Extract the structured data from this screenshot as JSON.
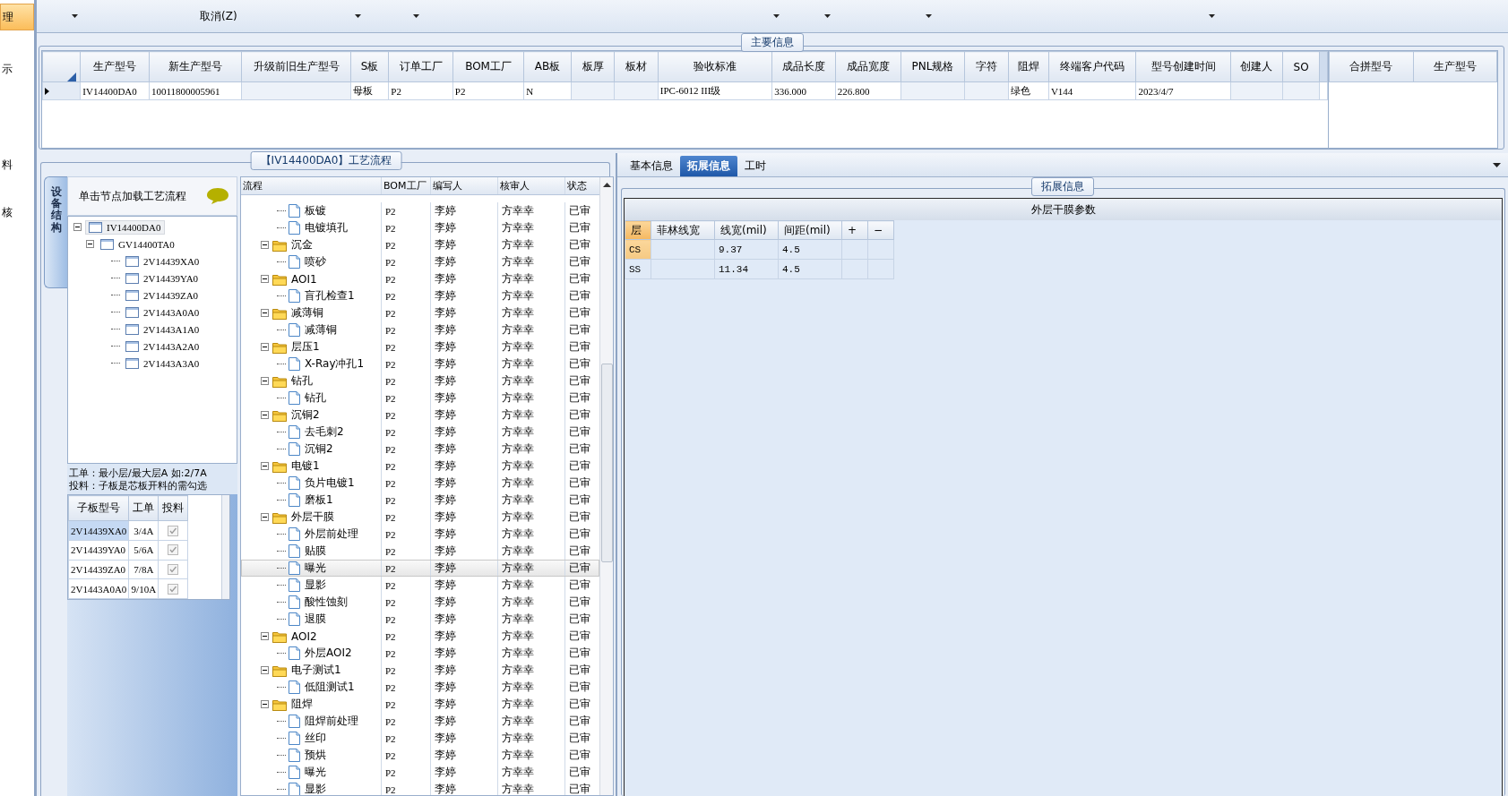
{
  "nav": [
    {
      "label": "理",
      "selected": true
    },
    {
      "label": "示",
      "selected": false
    },
    {
      "label": "料",
      "selected": false
    },
    {
      "label": "核",
      "selected": false
    }
  ],
  "toolbar": [
    {
      "kind": "dropdown"
    },
    {
      "kind": "button",
      "label": "取消(Z)"
    },
    {
      "kind": "dropdown"
    },
    {
      "kind": "dropdown"
    },
    {
      "kind": "dropdown"
    },
    {
      "kind": "dropdown"
    },
    {
      "kind": "dropdown"
    },
    {
      "kind": "dropdown"
    }
  ],
  "main_info": {
    "title": "主要信息",
    "columns": [
      "生产型号",
      "新生产型号",
      "升级前旧生产型号",
      "S板",
      "订单工厂",
      "BOM工厂",
      "AB板",
      "板厚",
      "板材",
      "验收标准",
      "成品长度",
      "成品宽度",
      "PNL规格",
      "字符",
      "阻焊",
      "终端客户代码",
      "型号创建时间",
      "创建人",
      "SO"
    ],
    "rows": [
      {
        "selected": true,
        "cells": [
          "IV14400DA0",
          "10011800005961",
          null,
          "母板",
          "P2",
          "P2",
          "N",
          null,
          null,
          "IPC-6012 III级",
          "336.000",
          "226.800",
          null,
          null,
          "绿色",
          "V144",
          "2023/4/7",
          null,
          null
        ]
      }
    ],
    "merge_columns": [
      "合拼型号",
      "生产型号"
    ]
  },
  "process": {
    "title": "【IV14400DA0】工艺流程",
    "side_tab": "设备结构",
    "tree_hint": "单击节点加载工艺流程",
    "tree": [
      {
        "label": "IV14400DA0",
        "selected": true,
        "expanded": true,
        "children": [
          {
            "label": "GV14400TA0",
            "selected": false,
            "expanded": true,
            "children": [
              {
                "label": "2V14439XA0",
                "selected": false
              },
              {
                "label": "2V14439YA0",
                "selected": false
              },
              {
                "label": "2V14439ZA0",
                "selected": false
              },
              {
                "label": "2V1443A0A0",
                "selected": false
              },
              {
                "label": "2V1443A1A0",
                "selected": false
              },
              {
                "label": "2V1443A2A0",
                "selected": false
              },
              {
                "label": "2V1443A3A0",
                "selected": false
              }
            ]
          }
        ]
      }
    ],
    "notes": [
      "工单：最小层/最大层A 如:2/7A",
      "投料：子板是芯板开料的需勾选"
    ],
    "sub_boards": {
      "columns": [
        "子板型号",
        "工单",
        "投料"
      ],
      "rows": [
        {
          "board": "2V14439XA0",
          "order": "3/4A",
          "checked": true,
          "selected": true
        },
        {
          "board": "2V14439YA0",
          "order": "5/6A",
          "checked": true,
          "selected": false
        },
        {
          "board": "2V14439ZA0",
          "order": "7/8A",
          "checked": true,
          "selected": false
        },
        {
          "board": "2V1443A0A0",
          "order": "9/10A",
          "checked": true,
          "selected": false
        }
      ]
    }
  },
  "flow": {
    "columns": [
      "流程",
      "BOM工厂",
      "编写人",
      "核审人",
      "状态"
    ],
    "rows": [
      {
        "children": [
          {
            "name": "板镀",
            "bom": "P2",
            "writer": "李婷",
            "reviewer": "方幸幸",
            "status": "已审",
            "selected": false
          },
          {
            "name": "电镀填孔",
            "bom": "P2",
            "writer": "李婷",
            "reviewer": "方幸幸",
            "status": "已审",
            "selected": false
          }
        ]
      },
      {
        "name": "沉金",
        "bom": "P2",
        "writer": "李婷",
        "reviewer": "方幸幸",
        "status": "已审",
        "selected": false,
        "expanded": true,
        "children": [
          {
            "name": "喷砂",
            "bom": "P2",
            "writer": "李婷",
            "reviewer": "方幸幸",
            "status": "已审",
            "selected": false
          }
        ]
      },
      {
        "name": "AOI1",
        "bom": "P2",
        "writer": "李婷",
        "reviewer": "方幸幸",
        "status": "已审",
        "selected": false,
        "expanded": true,
        "children": [
          {
            "name": "盲孔检查1",
            "bom": "P2",
            "writer": "李婷",
            "reviewer": "方幸幸",
            "status": "已审",
            "selected": false
          }
        ]
      },
      {
        "name": "减薄铜",
        "bom": "P2",
        "writer": "李婷",
        "reviewer": "方幸幸",
        "status": "已审",
        "selected": false,
        "expanded": true,
        "children": [
          {
            "name": "减薄铜",
            "bom": "P2",
            "writer": "李婷",
            "reviewer": "方幸幸",
            "status": "已审",
            "selected": false
          }
        ]
      },
      {
        "name": "层压1",
        "bom": "P2",
        "writer": "李婷",
        "reviewer": "方幸幸",
        "status": "已审",
        "selected": false,
        "expanded": true,
        "children": [
          {
            "name": "X-Ray冲孔1",
            "bom": "P2",
            "writer": "李婷",
            "reviewer": "方幸幸",
            "status": "已审",
            "selected": false
          }
        ]
      },
      {
        "name": "钻孔",
        "bom": "P2",
        "writer": "李婷",
        "reviewer": "方幸幸",
        "status": "已审",
        "selected": false,
        "expanded": true,
        "children": [
          {
            "name": "钻孔",
            "bom": "P2",
            "writer": "李婷",
            "reviewer": "方幸幸",
            "status": "已审",
            "selected": false
          }
        ]
      },
      {
        "name": "沉铜2",
        "bom": "P2",
        "writer": "李婷",
        "reviewer": "方幸幸",
        "status": "已审",
        "selected": false,
        "expanded": true,
        "children": [
          {
            "name": "去毛刺2",
            "bom": "P2",
            "writer": "李婷",
            "reviewer": "方幸幸",
            "status": "已审",
            "selected": false
          },
          {
            "name": "沉铜2",
            "bom": "P2",
            "writer": "李婷",
            "reviewer": "方幸幸",
            "status": "已审",
            "selected": false
          }
        ]
      },
      {
        "name": "电镀1",
        "bom": "P2",
        "writer": "李婷",
        "reviewer": "方幸幸",
        "status": "已审",
        "selected": false,
        "expanded": true,
        "children": [
          {
            "name": "负片电镀1",
            "bom": "P2",
            "writer": "李婷",
            "reviewer": "方幸幸",
            "status": "已审",
            "selected": false
          },
          {
            "name": "磨板1",
            "bom": "P2",
            "writer": "李婷",
            "reviewer": "方幸幸",
            "status": "已审",
            "selected": false
          }
        ]
      },
      {
        "name": "外层干膜",
        "bom": "P2",
        "writer": "李婷",
        "reviewer": "方幸幸",
        "status": "已审",
        "selected": false,
        "expanded": true,
        "children": [
          {
            "name": "外层前处理",
            "bom": "P2",
            "writer": "李婷",
            "reviewer": "方幸幸",
            "status": "已审",
            "selected": false
          },
          {
            "name": "贴膜",
            "bom": "P2",
            "writer": "李婷",
            "reviewer": "方幸幸",
            "status": "已审",
            "selected": false
          },
          {
            "name": "曝光",
            "bom": "P2",
            "writer": "李婷",
            "reviewer": "方幸幸",
            "status": "已审",
            "selected": true
          },
          {
            "name": "显影",
            "bom": "P2",
            "writer": "李婷",
            "reviewer": "方幸幸",
            "status": "已审",
            "selected": false
          },
          {
            "name": "酸性蚀刻",
            "bom": "P2",
            "writer": "李婷",
            "reviewer": "方幸幸",
            "status": "已审",
            "selected": false
          },
          {
            "name": "退膜",
            "bom": "P2",
            "writer": "李婷",
            "reviewer": "方幸幸",
            "status": "已审",
            "selected": false
          }
        ]
      },
      {
        "name": "AOI2",
        "bom": "P2",
        "writer": "李婷",
        "reviewer": "方幸幸",
        "status": "已审",
        "selected": false,
        "expanded": true,
        "children": [
          {
            "name": "外层AOI2",
            "bom": "P2",
            "writer": "李婷",
            "reviewer": "方幸幸",
            "status": "已审",
            "selected": false
          }
        ]
      },
      {
        "name": "电子测试1",
        "bom": "P2",
        "writer": "李婷",
        "reviewer": "方幸幸",
        "status": "已审",
        "selected": false,
        "expanded": true,
        "children": [
          {
            "name": "低阻测试1",
            "bom": "P2",
            "writer": "李婷",
            "reviewer": "方幸幸",
            "status": "已审",
            "selected": false
          }
        ]
      },
      {
        "name": "阻焊",
        "bom": "P2",
        "writer": "李婷",
        "reviewer": "方幸幸",
        "status": "已审",
        "selected": false,
        "expanded": true,
        "children": [
          {
            "name": "阻焊前处理",
            "bom": "P2",
            "writer": "李婷",
            "reviewer": "方幸幸",
            "status": "已审",
            "selected": false
          },
          {
            "name": "丝印",
            "bom": "P2",
            "writer": "李婷",
            "reviewer": "方幸幸",
            "status": "已审",
            "selected": false
          },
          {
            "name": "预烘",
            "bom": "P2",
            "writer": "李婷",
            "reviewer": "方幸幸",
            "status": "已审",
            "selected": false
          },
          {
            "name": "曝光",
            "bom": "P2",
            "writer": "李婷",
            "reviewer": "方幸幸",
            "status": "已审",
            "selected": false
          },
          {
            "name": "显影",
            "bom": "P2",
            "writer": "李婷",
            "reviewer": "方幸幸",
            "status": "已审",
            "selected": false
          }
        ]
      }
    ]
  },
  "detail": {
    "tabs": [
      {
        "label": "基本信息",
        "selected": false
      },
      {
        "label": "拓展信息",
        "selected": true
      },
      {
        "label": "工时",
        "selected": false
      }
    ],
    "group_title": "拓展信息",
    "table": {
      "title": "外层干膜参数",
      "columns": [
        "层",
        "菲林线宽",
        "线宽(mil)",
        "间距(mil)",
        "+",
        "−"
      ],
      "rows": [
        {
          "selected": true,
          "cells": [
            "CS",
            null,
            "9.37",
            "4.5",
            null,
            null
          ]
        },
        {
          "selected": false,
          "cells": [
            "SS",
            null,
            "11.34",
            "4.5",
            null,
            null
          ]
        }
      ]
    }
  }
}
